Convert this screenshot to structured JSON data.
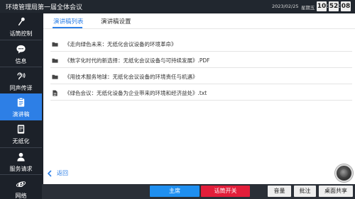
{
  "app": {
    "title": "环境管理局第一届全体会议"
  },
  "status": {
    "date": "2023/02/25",
    "weekday": "星期五",
    "clock": {
      "hh": "10",
      "mm": "52",
      "ss": "08",
      "sep": ":"
    }
  },
  "sidebar": {
    "items": [
      {
        "label": "话筒控制",
        "icon": "microphone-icon"
      },
      {
        "label": "信息",
        "icon": "chat-bubble-icon"
      },
      {
        "label": "同声传译",
        "icon": "ear-icon"
      },
      {
        "label": "演讲稿",
        "icon": "document-icon",
        "active": true
      },
      {
        "label": "无纸化",
        "icon": "tablet-icon"
      },
      {
        "label": "服务请求",
        "icon": "user-icon"
      },
      {
        "label": "网络",
        "icon": "browser-icon"
      }
    ]
  },
  "tabs": [
    {
      "label": "演讲稿列表",
      "active": true
    },
    {
      "label": "演讲稿设置",
      "active": false
    }
  ],
  "files": [
    {
      "name": "《走向绿色未来：无纸化会议设备的环境革命》",
      "type": "folder",
      "icon": "folder-icon"
    },
    {
      "name": "《数字化时代的新选择：无纸化会议设备与可持续发展》.PDF",
      "type": "folder",
      "icon": "folder-icon"
    },
    {
      "name": "《用技术服务地球：无纸化会议设备的环境责任与机遇》",
      "type": "folder",
      "icon": "folder-icon"
    },
    {
      "name": "《绿色会议：无纸化设备为企业带来的环境和经济益处》.txt",
      "type": "file",
      "icon": "file-icon"
    }
  ],
  "back": {
    "label": "返回"
  },
  "bottombar": {
    "chair": "主席",
    "mic_switch": "话筒开关",
    "volume": "音量",
    "annotate": "批注",
    "desktop_share": "桌面共享"
  },
  "colors": {
    "accent": "#2d7fe6",
    "danger": "#e21e3a",
    "dark_bg": "#1c2129"
  }
}
